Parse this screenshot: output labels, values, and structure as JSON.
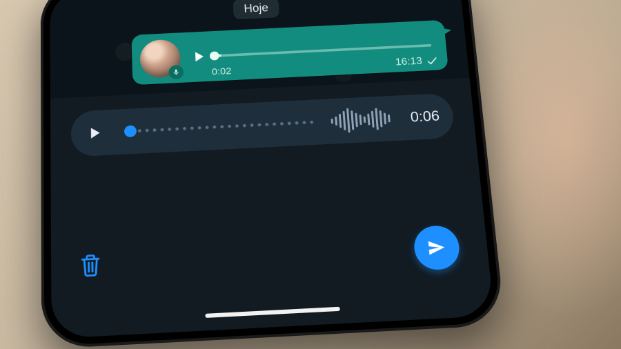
{
  "chat": {
    "date_label": "Hoje"
  },
  "sent_message": {
    "elapsed": "0:02",
    "timestamp": "16:13",
    "progress_pct": 3
  },
  "draft_recorder": {
    "duration": "0:06",
    "progress_pct": 5,
    "waveform_bars": [
      8,
      14,
      22,
      30,
      38,
      30,
      22,
      16,
      10,
      18,
      26,
      34,
      26,
      18,
      12
    ]
  },
  "colors": {
    "accent_blue": "#1e8fff",
    "bubble_green": "#128c7e",
    "panel_bg": "#121b22",
    "recorder_bg": "#1f2e3b"
  },
  "icons": {
    "play": "play-icon",
    "mic": "mic-icon",
    "check": "check-icon",
    "trash": "trash-icon",
    "send": "send-icon"
  }
}
